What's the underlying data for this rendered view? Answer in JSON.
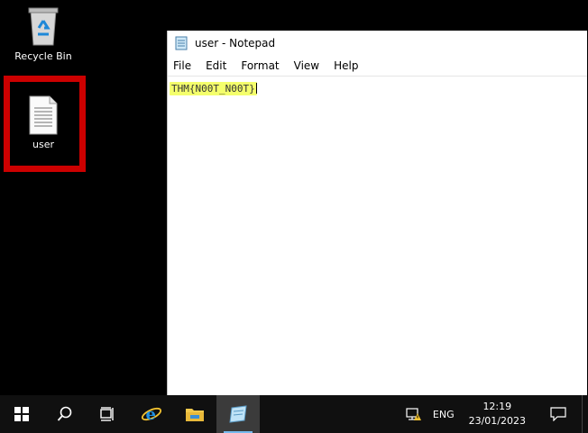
{
  "desktop": {
    "icons": [
      {
        "label": "Recycle Bin"
      },
      {
        "label": "user"
      }
    ]
  },
  "notepad": {
    "title": "user - Notepad",
    "menu": [
      "File",
      "Edit",
      "Format",
      "View",
      "Help"
    ],
    "content": "THM{N00T_N00T}"
  },
  "taskbar": {
    "apps": [
      "start-icon",
      "search-icon",
      "task-view-icon",
      "internet-explorer-icon",
      "file-explorer-icon",
      "notepad-icon"
    ],
    "language": "ENG",
    "time": "12:19",
    "date": "23/01/2023"
  },
  "colors": {
    "highlight_border": "#cc0000",
    "text_highlight": "#f4ff6c",
    "taskbar": "#101010",
    "accent": "#76b9ed"
  }
}
